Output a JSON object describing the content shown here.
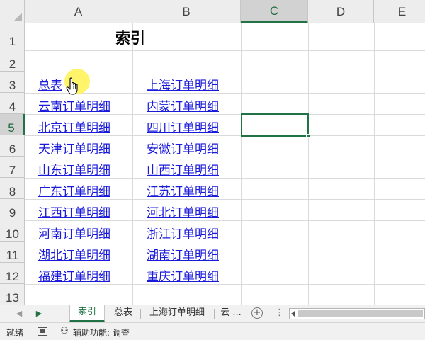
{
  "columns": [
    "A",
    "B",
    "C",
    "D",
    "E"
  ],
  "selected_column": "C",
  "rows": [
    "1",
    "2",
    "3",
    "4",
    "5",
    "6",
    "7",
    "8",
    "9",
    "10",
    "11",
    "12",
    "13"
  ],
  "selected_row": "5",
  "sheet": {
    "title": "索引",
    "col_a_links": [
      "总表",
      "云南订单明细",
      "北京订单明细",
      "天津订单明细",
      "山东订单明细",
      "广东订单明细",
      "江西订单明细",
      "河南订单明细",
      "湖北订单明细",
      "福建订单明细"
    ],
    "col_b_links": [
      "上海订单明细",
      "内蒙订单明细",
      "四川订单明细",
      "安徽订单明细",
      "山西订单明细",
      "江苏订单明细",
      "河北订单明细",
      "浙江订单明细",
      "湖南订单明细",
      "重庆订单明细"
    ]
  },
  "selected_cell": "C5",
  "tabs": {
    "items": [
      "索引",
      "总表",
      "上海订单明细",
      "云 ..."
    ],
    "active": "索引",
    "add_label": "+",
    "more_label": "⋮"
  },
  "status": {
    "ready": "就绪",
    "accessibility": "辅助功能: 调查"
  },
  "colors": {
    "accent": "#217346",
    "link": "#1a1adb",
    "highlight": "#fff250"
  },
  "icons": [
    "select-all-triangle-icon",
    "scroll-right-icon",
    "add-sheet-icon",
    "page-layout-icon",
    "accessibility-icon",
    "hand-cursor-icon"
  ]
}
